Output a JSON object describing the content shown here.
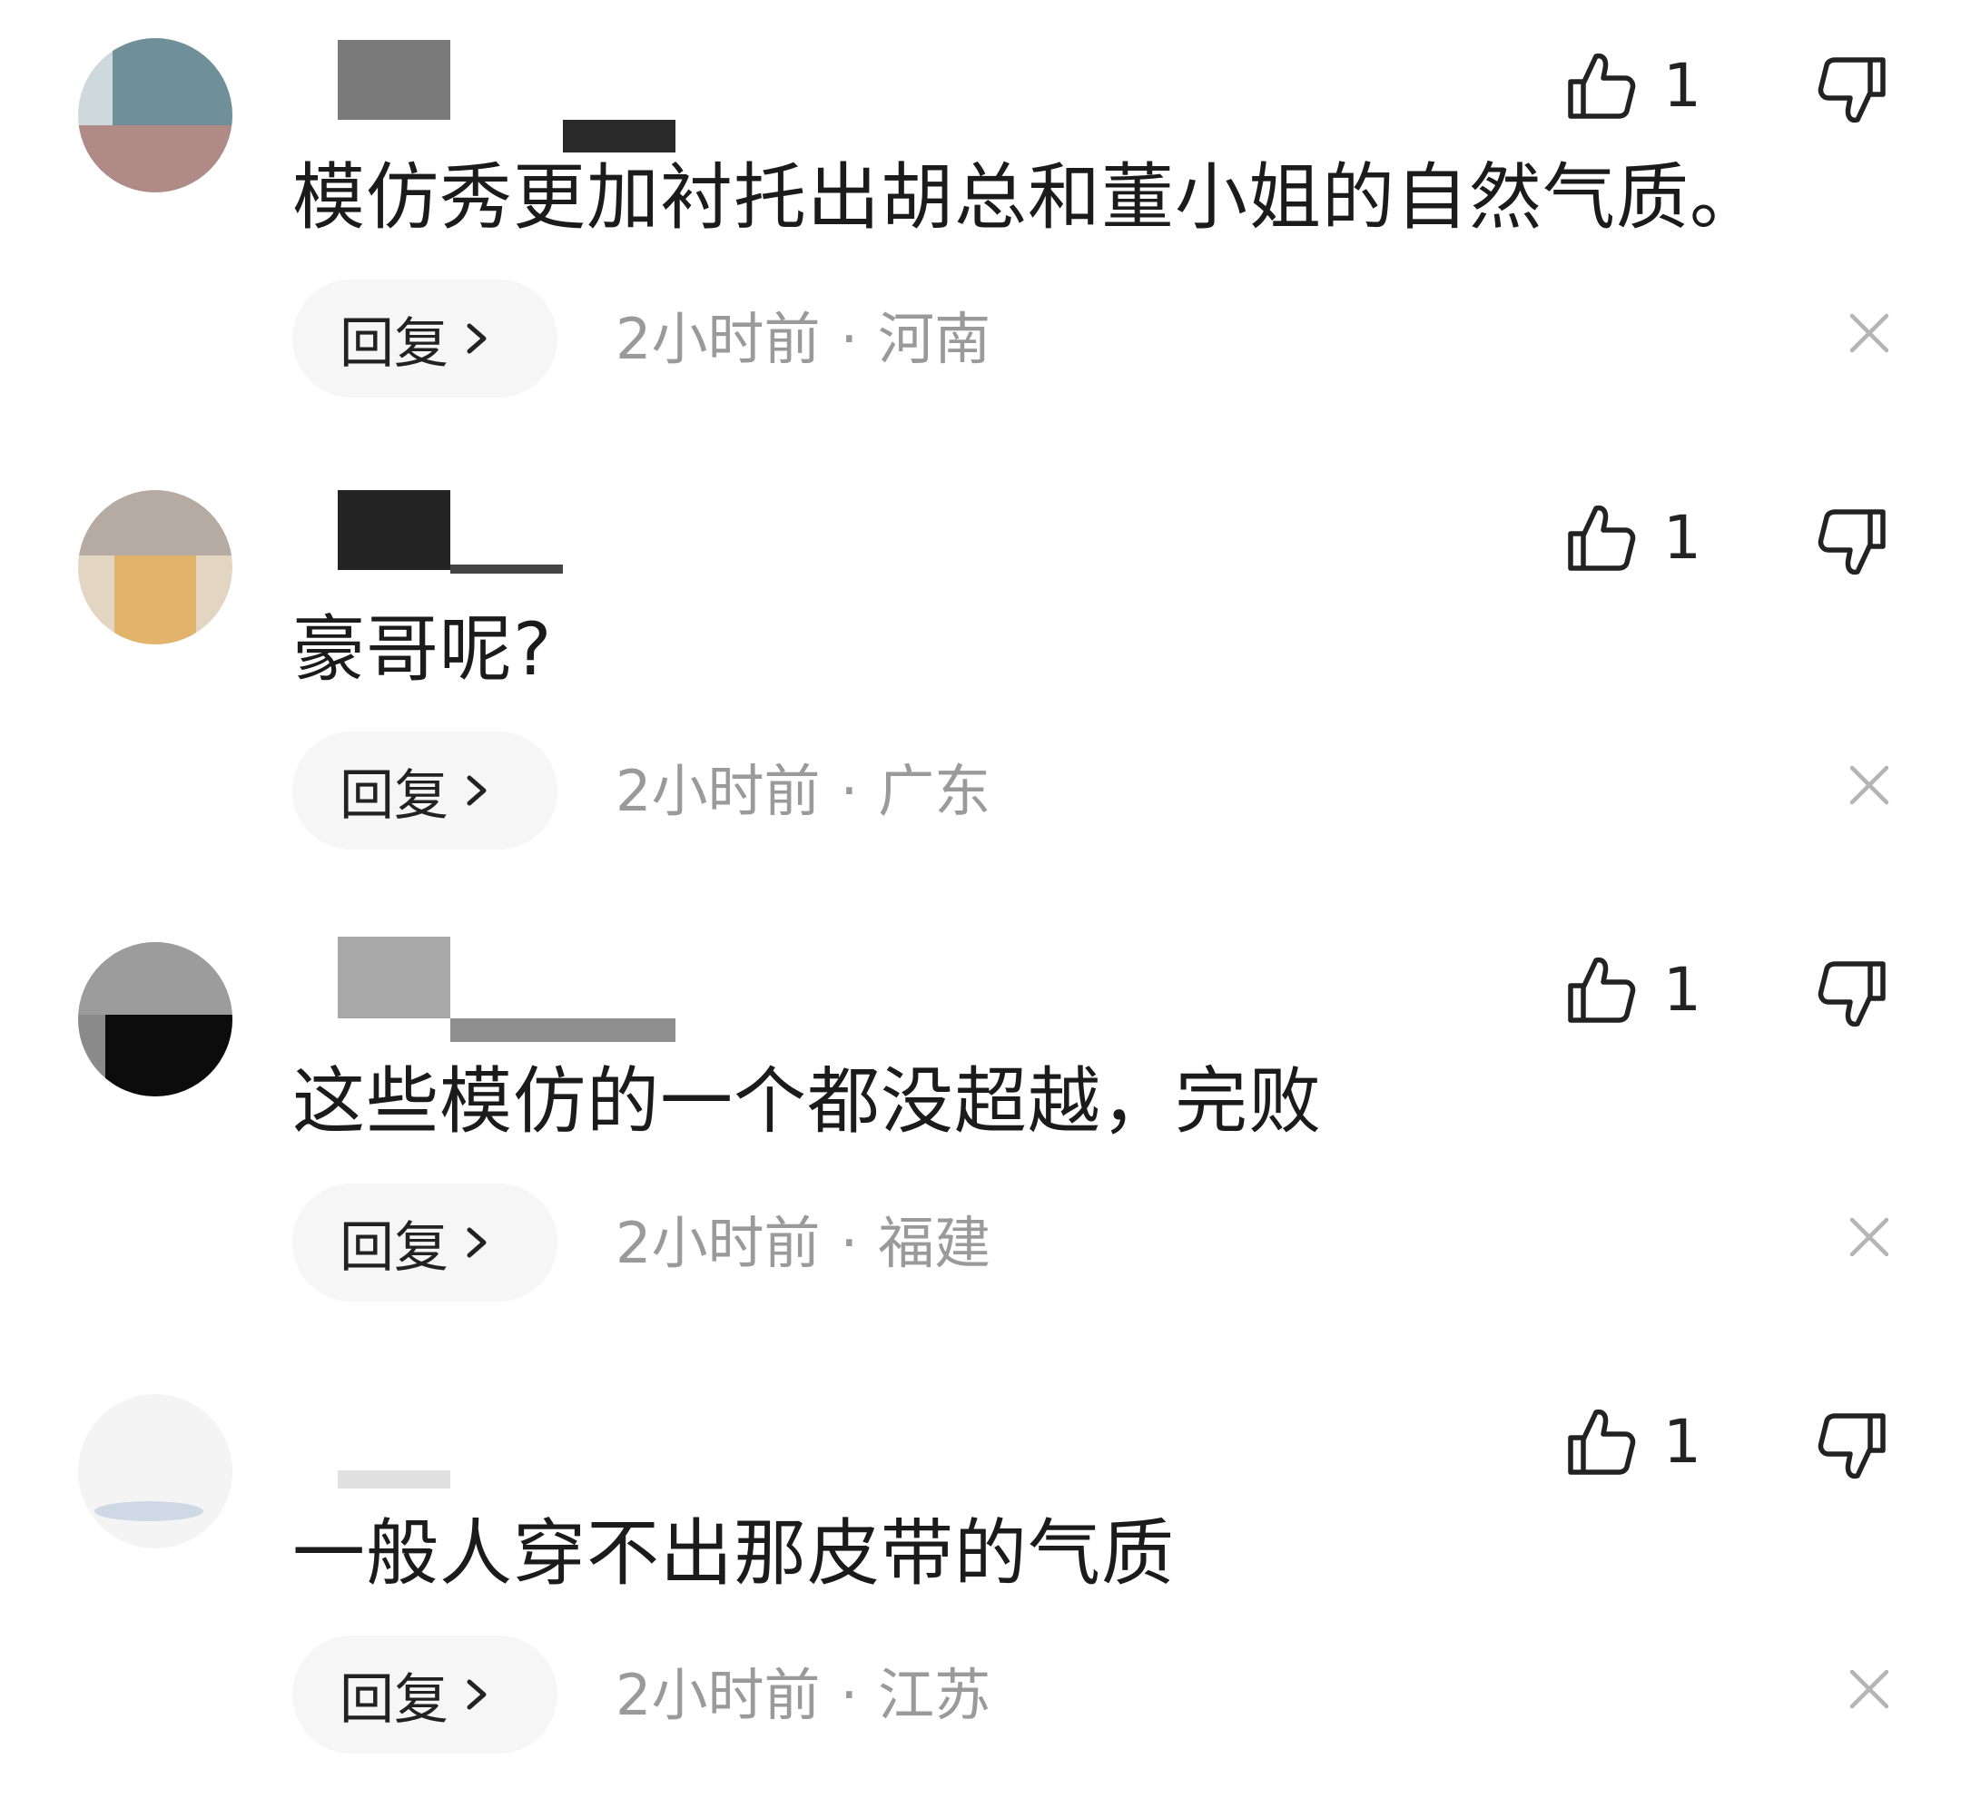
{
  "comments": [
    {
      "text": "模仿秀更加衬托出胡总和董小姐的自然气质。",
      "time": "2小时前",
      "separator": "·",
      "location": "河南",
      "likes": "1",
      "reply_label": "回复"
    },
    {
      "text": "豪哥呢?",
      "time": "2小时前",
      "separator": "·",
      "location": "广东",
      "likes": "1",
      "reply_label": "回复"
    },
    {
      "text": "这些模仿的一个都没超越，完败",
      "time": "2小时前",
      "separator": "·",
      "location": "福建",
      "likes": "1",
      "reply_label": "回复"
    },
    {
      "text": "一般人穿不出那皮带的气质",
      "time": "2小时前",
      "separator": "·",
      "location": "江苏",
      "likes": "1",
      "reply_label": "回复"
    }
  ],
  "icons": {
    "like": "thumbs-up-icon",
    "dislike": "thumbs-down-icon",
    "close": "close-icon",
    "chevron": "chevron-right-icon"
  },
  "colors": {
    "text": "#1b1b1b",
    "meta": "#9a9a9a",
    "pill": "#f6f6f6"
  }
}
